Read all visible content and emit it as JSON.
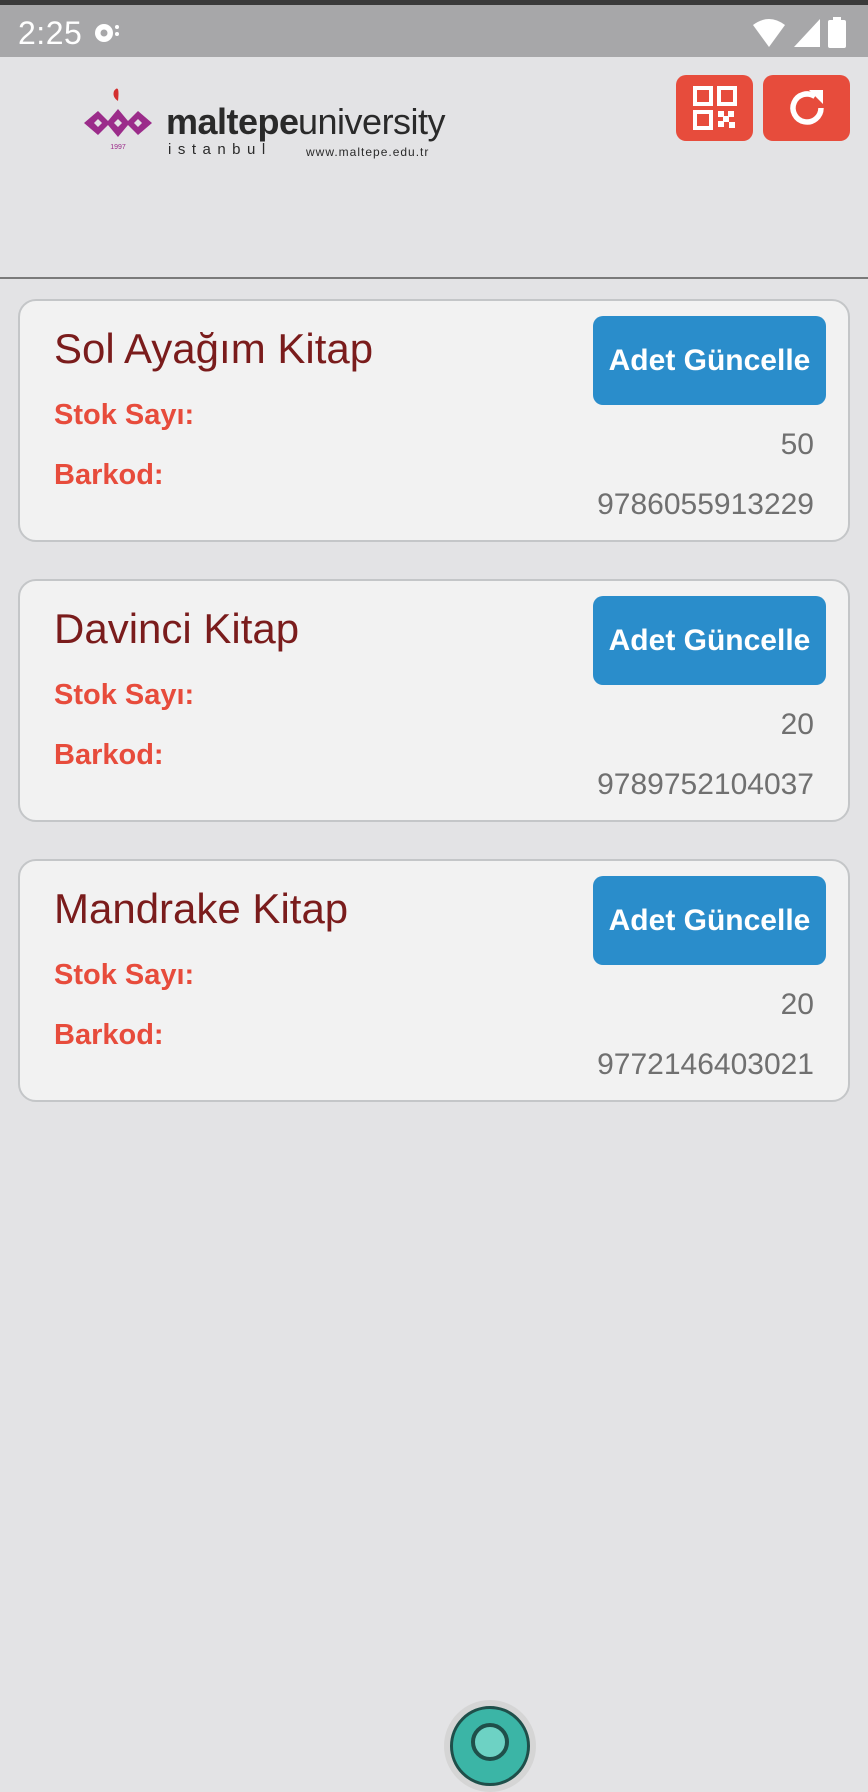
{
  "status_bar": {
    "time": "2:25",
    "icons": [
      "notification-icon",
      "wifi-icon",
      "signal-icon",
      "battery-icon"
    ]
  },
  "header": {
    "logo": {
      "name_bold": "maltepe",
      "name_light": "university",
      "city": "istanbul",
      "url": "www.maltepe.edu.tr",
      "year": "1997"
    },
    "buttons": [
      {
        "icon": "qr-code-icon"
      },
      {
        "icon": "refresh-icon"
      }
    ],
    "accent": "#e74c3c"
  },
  "labels": {
    "stock": "Stok Sayı:",
    "barcode": "Barkod:",
    "update_button": "Adet Güncelle"
  },
  "books": [
    {
      "title": "Sol Ayağım Kitap",
      "stock": "50",
      "barcode": "9786055913229"
    },
    {
      "title": "Davinci Kitap",
      "stock": "20",
      "barcode": "9789752104037"
    },
    {
      "title": "Mandrake Kitap",
      "stock": "20",
      "barcode": "9772146403021"
    }
  ],
  "colors": {
    "title": "#7a1c1c",
    "label": "#e74c3c",
    "button": "#2a8dcb",
    "card_bg": "#f2f2f2",
    "page_bg": "#e3e3e5"
  }
}
